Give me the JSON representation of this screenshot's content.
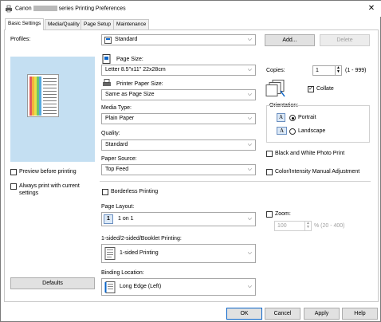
{
  "window": {
    "title_prefix": "Canon",
    "title_suffix": "series Printing Preferences",
    "close_glyph": "✕"
  },
  "tabs": [
    {
      "label": "Basic Settings"
    },
    {
      "label": "Media/Quality"
    },
    {
      "label": "Page Setup"
    },
    {
      "label": "Maintenance"
    }
  ],
  "profiles": {
    "label": "Profiles:",
    "value": "Standard",
    "add_label": "Add...",
    "delete_label": "Delete"
  },
  "preview": {
    "preview_before_printing": "Preview before printing",
    "always_print_line1": "Always print with current",
    "always_print_line2": "settings",
    "defaults_label": "Defaults"
  },
  "page_size": {
    "label": "Page Size:",
    "value": "Letter 8.5\"x11\" 22x28cm"
  },
  "printer_paper_size": {
    "label": "Printer Paper Size:",
    "value": "Same as Page Size"
  },
  "media_type": {
    "label": "Media Type:",
    "value": "Plain Paper"
  },
  "quality": {
    "label": "Quality:",
    "value": "Standard"
  },
  "paper_source": {
    "label": "Paper Source:",
    "value": "Top Feed"
  },
  "borderless": {
    "label": "Borderless Printing"
  },
  "page_layout": {
    "label": "Page Layout:",
    "value": "1 on 1",
    "icon_text": "1"
  },
  "duplex": {
    "label": "1-sided/2-sided/Booklet Printing:",
    "value": "1-sided Printing"
  },
  "binding": {
    "label": "Binding Location:",
    "value": "Long Edge (Left)"
  },
  "copies": {
    "label": "Copies:",
    "value": "1",
    "range": "(1 - 999)",
    "collate": "Collate"
  },
  "orientation": {
    "label": "Orientation:",
    "portrait": "Portrait",
    "landscape": "Landscape",
    "icon_letter": "A"
  },
  "bw_photo": {
    "label": "Black and White Photo Print"
  },
  "color_manual": {
    "label": "Color/Intensity Manual Adjustment"
  },
  "zoom": {
    "label": "Zoom:",
    "value": "100",
    "range": "% (20 - 400)"
  },
  "footer": {
    "ok": "OK",
    "cancel": "Cancel",
    "apply": "Apply",
    "help": "Help"
  },
  "colors": {
    "accent": "#0a64c8",
    "button_bg": "#e1e1e1",
    "panel_border": "#c8c8c8"
  }
}
